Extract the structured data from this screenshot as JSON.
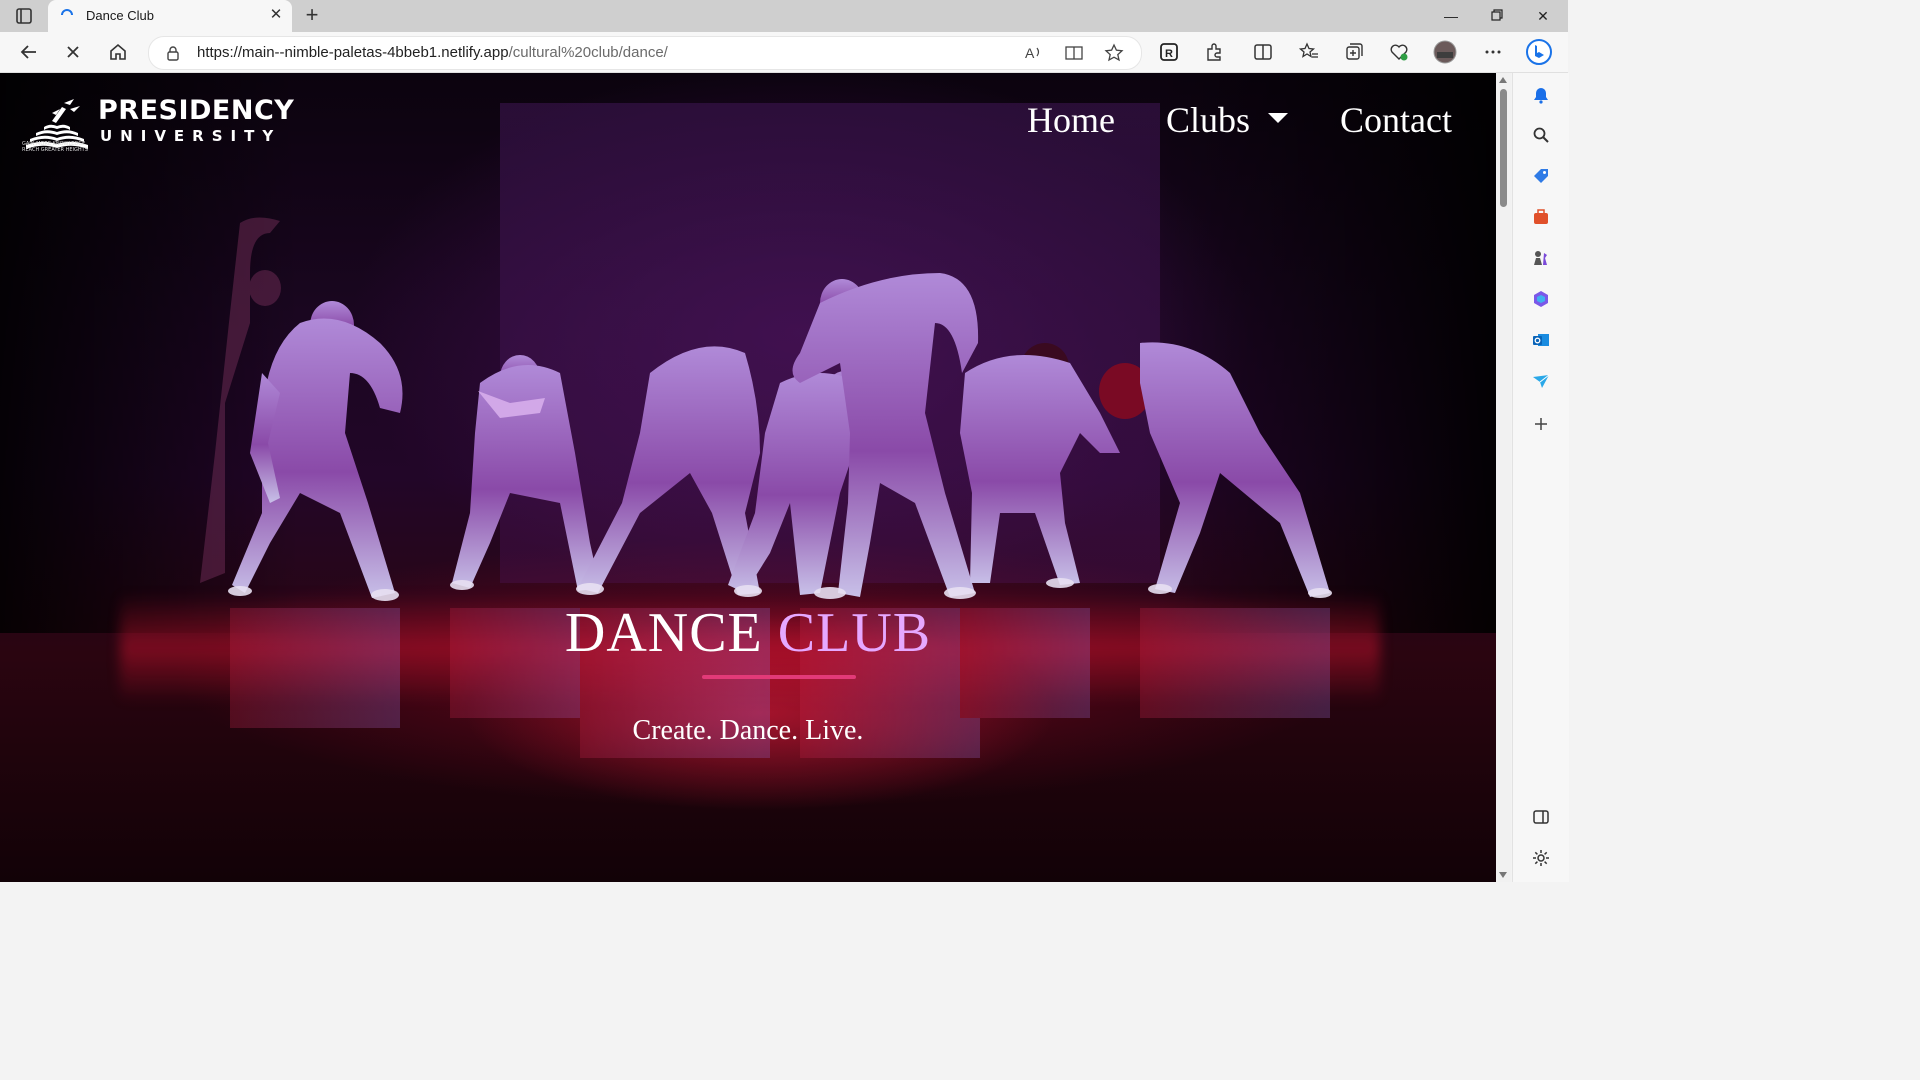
{
  "browser": {
    "tab": {
      "title": "Dance Club"
    },
    "address": {
      "url_host": "https://main--nimble-paletas-4bbeb1.netlify.app",
      "url_path": "/cultural%20club/dance/"
    }
  },
  "site": {
    "logo": {
      "name": "PRESIDENCY",
      "sub": "UNIVERSITY",
      "tagline": "GAIN MORE KNOWLEDGE REACH GREATER HEIGHTS"
    },
    "nav": {
      "home": "Home",
      "clubs": "Clubs",
      "contact": "Contact"
    },
    "hero": {
      "title_a": "DANCE ",
      "title_b": "CLUB",
      "tagline": "Create. Dance. Live."
    }
  },
  "colors": {
    "accent_line": "#e23a78",
    "title_highlight": "#e6a8ff"
  }
}
